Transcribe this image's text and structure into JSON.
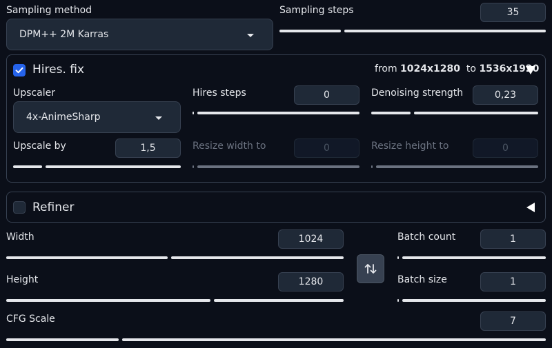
{
  "sampling": {
    "method_label": "Sampling method",
    "method_value": "DPM++ 2M Karras",
    "steps_label": "Sampling steps",
    "steps_value": "35"
  },
  "hires": {
    "title": "Hires. fix",
    "enabled": true,
    "from_text": "from",
    "from_size": "1024x1280",
    "to_text": "to",
    "to_size": "1536x1920",
    "upscaler_label": "Upscaler",
    "upscaler_value": "4x-AnimeSharp",
    "steps_label": "Hires steps",
    "steps_value": "0",
    "denoise_label": "Denoising strength",
    "denoise_value": "0,23",
    "upscale_by_label": "Upscale by",
    "upscale_by_value": "1,5",
    "resize_w_label": "Resize width to",
    "resize_w_value": "0",
    "resize_h_label": "Resize height to",
    "resize_h_value": "0"
  },
  "refiner": {
    "title": "Refiner",
    "enabled": false
  },
  "size": {
    "width_label": "Width",
    "width_value": "1024",
    "height_label": "Height",
    "height_value": "1280"
  },
  "batch": {
    "count_label": "Batch count",
    "count_value": "1",
    "size_label": "Batch size",
    "size_value": "1"
  },
  "cfg": {
    "label": "CFG Scale",
    "value": "7"
  },
  "slider_levels": {
    "sampling_steps": 0.23,
    "hires_steps": 0.0,
    "denoising_strength": 0.23,
    "upscale_by": 0.17,
    "resize_width": 0.0,
    "resize_height": 0.0,
    "width": 0.49,
    "height": 0.6,
    "batch_count": 0.0,
    "batch_size": 0.0,
    "cfg_scale": 0.2
  },
  "icons": {
    "hires_collapse": "triangle-down-icon",
    "refiner_expand": "triangle-left-icon",
    "swap": "swap-vertical-icon",
    "dropdown": "chevron-down-icon"
  }
}
